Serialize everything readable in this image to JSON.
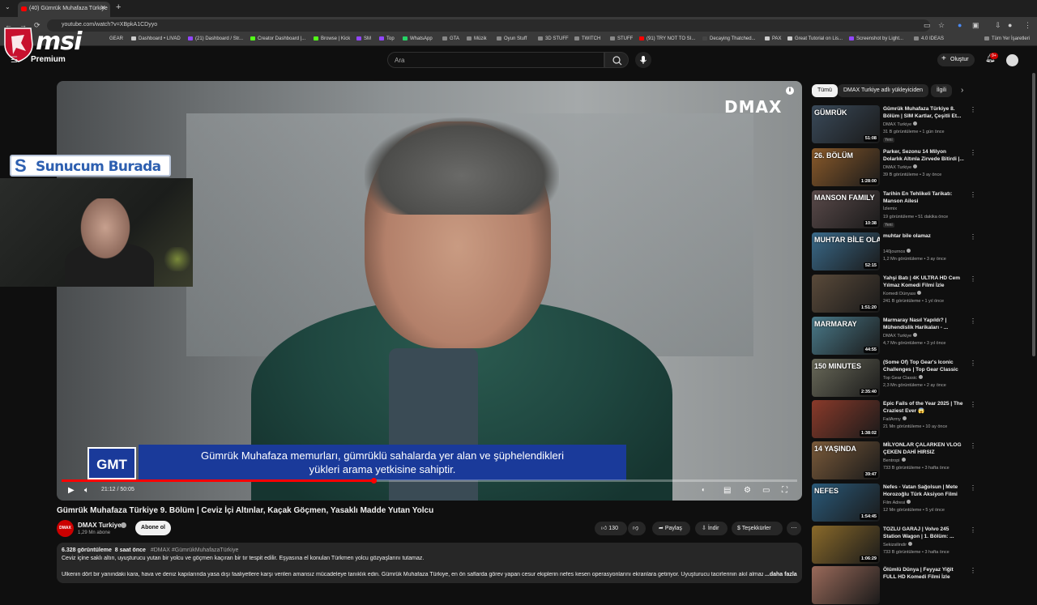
{
  "browser": {
    "tab_title": "(40) Gümrük Muhafaza Türkiye",
    "url": "youtube.com/watch?v=XBpkA1CDyyo",
    "bookmarks": [
      "GEAR",
      "Dashboard • LIVAD",
      "(21) Dashboard / Str...",
      "Creator Dashboard |...",
      "Browse | Kick",
      "SM",
      "Top",
      "WhatsApp",
      "GTA",
      "Müzik",
      "Oyun Stuff",
      "3D STUFF",
      "TWITCH",
      "STUFF",
      "(91) TRY NOT TO SI...",
      "Decaying Thatched...",
      "PAX",
      "Great Tutorial on Lis...",
      "Screenshot by Light...",
      "4.0 IDEAS",
      "Tüm Yer İşaretleri"
    ]
  },
  "overlay": {
    "msi_logo": "msi",
    "banner": "Sunucum Burada"
  },
  "header": {
    "premium_label": "Premium",
    "search_placeholder": "Ara",
    "create_label": "Oluştur",
    "notifications_badge": "9+"
  },
  "player": {
    "watermark": "DMAX",
    "lower_third_logo": "GMT",
    "subtitle_line1": "Gümrük Muhafaza memurları, gümrüklü sahalarda yer alan ve şüphelendikleri",
    "subtitle_line2": "yükleri arama yetkisine sahiptir.",
    "time": "21:12 / 50:05",
    "progress": 0.424
  },
  "video": {
    "title": "Gümrük Muhafaza Türkiye 9. Bölüm | Ceviz İçi Altınlar, Kaçak Göçmen, Yasaklı Madde Yutan Yolcu",
    "channel_avatar": "DMAX",
    "channel": "DMAX Turkiye",
    "subscribers": "1,29 Mn abone",
    "subscribe_label": "Abone ol",
    "likes": "130",
    "share_label": "Paylaş",
    "download_label": "İndir",
    "thanks_label": "Teşekkürler",
    "views": "6.328 görüntüleme",
    "age": "8 saat önce",
    "hashtags": "#DMAX #GümrükMuhafazaTürkiye",
    "desc_line1": "Ceviz içine saklı altın, uyuşturucu yutan bir yolcu ve göçmen kaçıran bir tır tespit edilir. Eşyasına el konulan Türkmen yolcu gözyaşlarını tutamaz.",
    "desc_line2": "Ülkenin dört bir yanındaki kara, hava ve deniz kapılarında yasa dışı faaliyetlere karşı verilen amansız mücadeleye tanıklık edin. Gümrük Muhafaza Türkiye, en ön saflarda görev yapan cesur ekiplerin nefes kesen operasyonlarını ekranlara getiriyor. Uyuşturucu tacirlerinin akıl almaz yö",
    "desc_more": "...daha fazla"
  },
  "sidebar": {
    "chips": [
      "Tümü",
      "DMAX Turkiye adlı yükleyiciden",
      "İlgili"
    ],
    "items": [
      {
        "title": "Gümrük Muhafaza Türkiye 8. Bölüm | SIM Kartlar, Çeşitli Et...",
        "channel": "DMAX Turkiye",
        "meta": "31 B görüntüleme • 1 gün önce",
        "badge": "Yeni",
        "duration": "51:08",
        "thumb_label": "GÜMRÜK",
        "color": "#3a4a5a",
        "verified": true
      },
      {
        "title": "Parker, Sezonu 14 Milyon Dolarlık Altınla Zirvede Bitirdi |...",
        "channel": "DMAX Turkiye",
        "meta": "39 B görüntüleme • 3 ay önce",
        "badge": "",
        "duration": "1:28:00",
        "thumb_label": "26. BÖLÜM",
        "color": "#8a5a2a",
        "verified": true
      },
      {
        "title": "Tarihin En Tehlikeli Tarikatı: Manson Ailesi",
        "channel": "İzlemix",
        "meta": "19 görüntüleme • 51 dakika önce",
        "badge": "Yeni",
        "duration": "10:38",
        "thumb_label": "MANSON FAMILY",
        "color": "#5a4a4a",
        "verified": false
      },
      {
        "title": "muhtar bile olamaz",
        "channel": "140journos",
        "meta": "1,2 Mn görüntüleme • 3 ay önce",
        "badge": "",
        "duration": "52:15",
        "thumb_label": "MUHTAR BİLE OLAMAZ",
        "color": "#3a6a8a",
        "verified": true
      },
      {
        "title": "Yahşi Batı | 4K ULTRA HD Cem Yılmaz Komedi Filmi İzle",
        "channel": "Komedi Dünyası",
        "meta": "241 B görüntüleme • 1 yıl önce",
        "badge": "",
        "duration": "1:51:20",
        "thumb_label": "",
        "color": "#5a4a3a",
        "verified": true
      },
      {
        "title": "Marmaray Nasıl Yapıldı? | Mühendislik Harikaları - ...",
        "channel": "DMAX Turkiye",
        "meta": "4,7 Mn görüntüleme • 3 yıl önce",
        "badge": "",
        "duration": "44:55",
        "thumb_label": "MARMARAY",
        "color": "#4a7a8a",
        "verified": true
      },
      {
        "title": "(Some Of) Top Gear's Iconic Challenges | Top Gear Classic",
        "channel": "Top Gear Classic",
        "meta": "2,3 Mn görüntüleme • 2 ay önce",
        "badge": "",
        "duration": "2:35:40",
        "thumb_label": "150 MINUTES",
        "color": "#6a6a5a",
        "verified": true
      },
      {
        "title": "Epic Fails of the Year 2025 | The Craziest Ever 😱",
        "channel": "FailArmy",
        "meta": "21 Mn görüntüleme • 10 ay önce",
        "badge": "",
        "duration": "1:38:02",
        "thumb_label": "",
        "color": "#8a3a2a",
        "verified": true
      },
      {
        "title": "MİLYONLAR ÇALARKEN VLOG ÇEKEN DAHİ HIRSIZ",
        "channel": "Bentropi",
        "meta": "733 B görüntüleme • 3 hafta önce",
        "badge": "",
        "duration": "39:47",
        "thumb_label": "14 YAŞINDA",
        "color": "#7a5a3a",
        "verified": true
      },
      {
        "title": "Nefes - Vatan Sağolsun | Mete Horozoğlu Türk Aksiyon Filmi",
        "channel": "Film Adresi",
        "meta": "12 Mn görüntüleme • 5 yıl önce",
        "badge": "",
        "duration": "1:54:45",
        "thumb_label": "NEFES",
        "color": "#2a5a7a",
        "verified": true
      },
      {
        "title": "TOZLU GARAJ | Volvo 245 Station Wagon | 1. Bölüm: ...",
        "channel": "Sekizsilindir",
        "meta": "733 B görüntüleme • 3 hafta önce",
        "badge": "",
        "duration": "1:06:29",
        "thumb_label": "",
        "color": "#8a6a2a",
        "verified": true
      },
      {
        "title": "Ölümlü Dünya | Feyyaz Yiğit FULL HD Komedi Filmi İzle",
        "channel": "",
        "meta": "",
        "badge": "",
        "duration": "",
        "thumb_label": "",
        "color": "#9a6a5a",
        "verified": false
      }
    ]
  },
  "colors": {
    "bg": "#0f0f0f",
    "surface": "#272727",
    "accent": "#ff0000",
    "subtitle_bar": "#1a3a9a",
    "banner_text": "#2d5fb0"
  }
}
